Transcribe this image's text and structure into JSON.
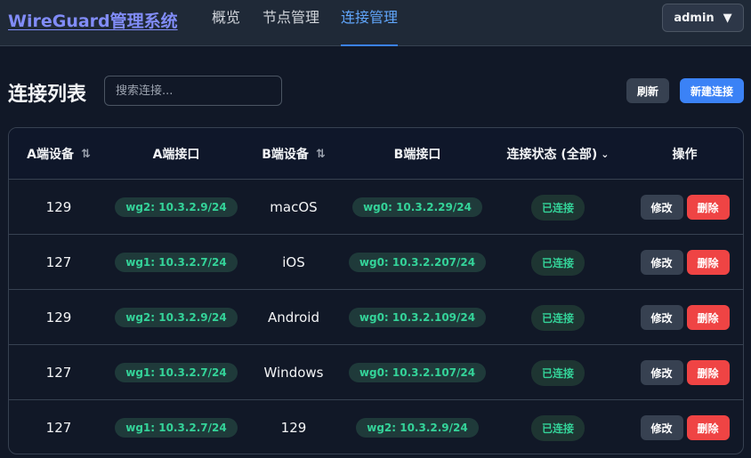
{
  "app": {
    "title": "WireGuard管理系统"
  },
  "nav": [
    {
      "label": "概览",
      "active": false
    },
    {
      "label": "节点管理",
      "active": false
    },
    {
      "label": "连接管理",
      "active": true
    }
  ],
  "user": {
    "name": "admin",
    "caret": "▼"
  },
  "page": {
    "title": "连接列表",
    "search_placeholder": "搜索连接...",
    "refresh_label": "刷新",
    "new_label": "新建连接"
  },
  "table": {
    "headers": {
      "a_device": "A端设备",
      "a_iface": "A端接口",
      "b_device": "B端设备",
      "b_iface": "B端接口",
      "status": "连接状态 (全部)",
      "actions": "操作"
    },
    "rows": [
      {
        "a_device": "129",
        "a_iface": "wg2: 10.3.2.9/24",
        "b_device": "macOS",
        "b_iface": "wg0: 10.3.2.29/24",
        "status": "已连接",
        "edit": "修改",
        "delete": "删除"
      },
      {
        "a_device": "127",
        "a_iface": "wg1: 10.3.2.7/24",
        "b_device": "iOS",
        "b_iface": "wg0: 10.3.2.207/24",
        "status": "已连接",
        "edit": "修改",
        "delete": "删除"
      },
      {
        "a_device": "129",
        "a_iface": "wg2: 10.3.2.9/24",
        "b_device": "Android",
        "b_iface": "wg0: 10.3.2.109/24",
        "status": "已连接",
        "edit": "修改",
        "delete": "删除"
      },
      {
        "a_device": "127",
        "a_iface": "wg1: 10.3.2.7/24",
        "b_device": "Windows",
        "b_iface": "wg0: 10.3.2.107/24",
        "status": "已连接",
        "edit": "修改",
        "delete": "删除"
      },
      {
        "a_device": "127",
        "a_iface": "wg1: 10.3.2.7/24",
        "b_device": "129",
        "b_iface": "wg2: 10.3.2.9/24",
        "status": "已连接",
        "edit": "修改",
        "delete": "删除"
      }
    ]
  },
  "colors": {
    "accent": "#3b82f6",
    "brand": "#818cf8",
    "success": "#34d399",
    "danger": "#ef4444"
  }
}
